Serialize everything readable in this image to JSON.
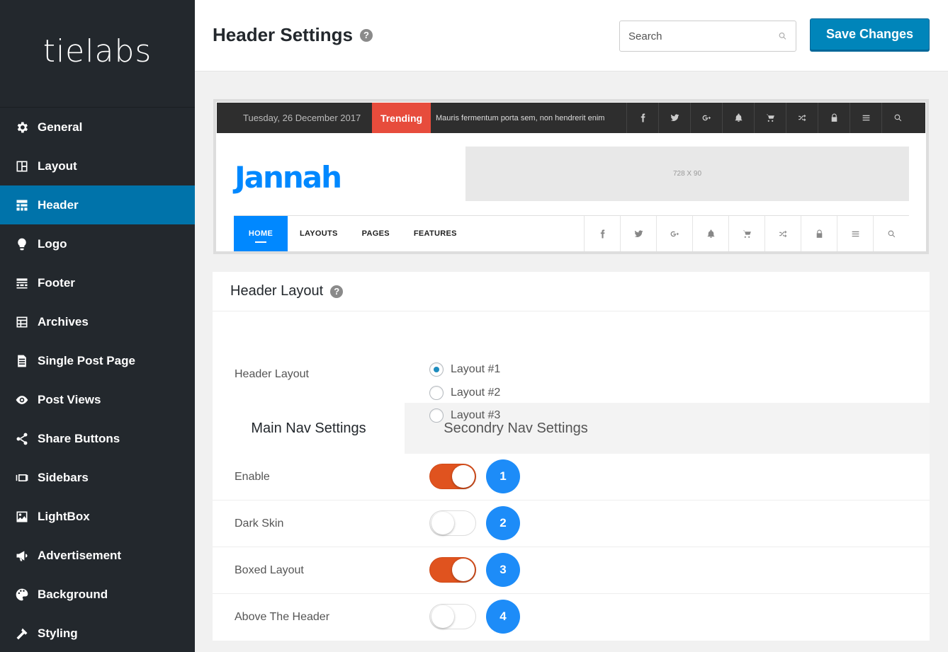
{
  "brand": {
    "name": "tielabs"
  },
  "sidebar": {
    "items": [
      {
        "label": "General",
        "icon": "gear-icon",
        "active": false
      },
      {
        "label": "Layout",
        "icon": "layout-icon",
        "active": false
      },
      {
        "label": "Header",
        "icon": "header-icon",
        "active": true
      },
      {
        "label": "Logo",
        "icon": "lightbulb-icon",
        "active": false
      },
      {
        "label": "Footer",
        "icon": "footer-icon",
        "active": false
      },
      {
        "label": "Archives",
        "icon": "archives-icon",
        "active": false
      },
      {
        "label": "Single Post Page",
        "icon": "document-icon",
        "active": false
      },
      {
        "label": "Post Views",
        "icon": "eye-icon",
        "active": false
      },
      {
        "label": "Share Buttons",
        "icon": "share-icon",
        "active": false
      },
      {
        "label": "Sidebars",
        "icon": "sidebars-icon",
        "active": false
      },
      {
        "label": "LightBox",
        "icon": "image-icon",
        "active": false
      },
      {
        "label": "Advertisement",
        "icon": "megaphone-icon",
        "active": false
      },
      {
        "label": "Background",
        "icon": "palette-icon",
        "active": false
      },
      {
        "label": "Styling",
        "icon": "hammer-icon",
        "active": false
      }
    ]
  },
  "header": {
    "title": "Header Settings",
    "help": "?",
    "search_placeholder": "Search",
    "save_label": "Save Changes"
  },
  "preview": {
    "date": "Tuesday, 26 December 2017",
    "trending": "Trending",
    "ticker": "Mauris fermentum porta sem, non hendrerit enim",
    "top_icons": [
      "facebook-icon",
      "twitter-icon",
      "google-plus-icon",
      "bell-icon",
      "cart-icon",
      "shuffle-icon",
      "lock-icon",
      "menu-icon",
      "search-icon"
    ],
    "logo": "Jannah",
    "ad": "728 X 90",
    "nav": [
      "HOME",
      "LAYOUTS",
      "PAGES",
      "FEATURES"
    ]
  },
  "layout_section": {
    "title": "Header Layout",
    "help": "?",
    "label": "Header Layout",
    "options": [
      {
        "label": "Layout #1",
        "checked": true
      },
      {
        "label": "Layout #2",
        "checked": false
      },
      {
        "label": "Layout #3",
        "checked": false
      }
    ]
  },
  "tabs": [
    {
      "label": "Main Nav Settings",
      "active": true
    },
    {
      "label": "Secondry Nav Settings",
      "active": false
    }
  ],
  "options": [
    {
      "label": "Enable",
      "on": true,
      "badge": "1"
    },
    {
      "label": "Dark Skin",
      "on": false,
      "badge": "2"
    },
    {
      "label": "Boxed Layout",
      "on": true,
      "badge": "3"
    },
    {
      "label": "Above The Header",
      "on": false,
      "badge": "4"
    }
  ],
  "colors": {
    "accent": "#0073aa",
    "toggle_on": "#e0531f",
    "badge": "#1d8cf8",
    "trending": "#e74c3c",
    "logo": "#0088ff"
  }
}
